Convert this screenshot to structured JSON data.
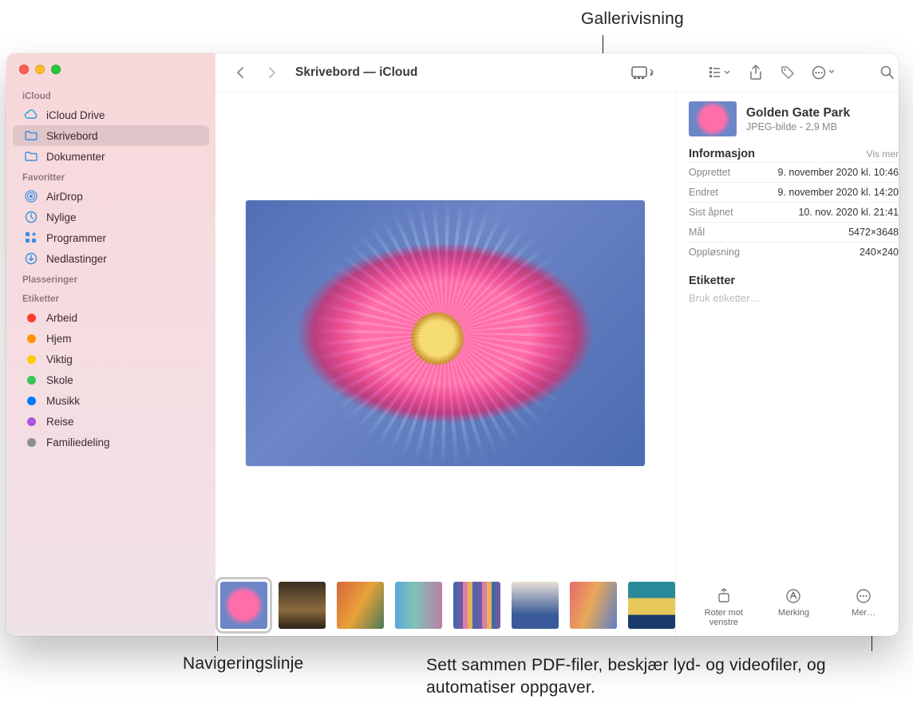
{
  "callouts": {
    "top": "Gallerivisning",
    "bottom_left": "Navigeringslinje",
    "bottom_right": "Sett sammen PDF-filer, beskjær lyd- og videofiler, og automatiser oppgaver."
  },
  "window_title": "Skrivebord — iCloud",
  "sidebar": {
    "sections": [
      {
        "header": "iCloud",
        "items": [
          {
            "label": "iCloud Drive",
            "icon": "cloud",
            "active": false
          },
          {
            "label": "Skrivebord",
            "icon": "folder",
            "active": true
          },
          {
            "label": "Dokumenter",
            "icon": "folder",
            "active": false
          }
        ]
      },
      {
        "header": "Favoritter",
        "items": [
          {
            "label": "AirDrop",
            "icon": "airdrop",
            "active": false
          },
          {
            "label": "Nylige",
            "icon": "clock",
            "active": false
          },
          {
            "label": "Programmer",
            "icon": "apps",
            "active": false
          },
          {
            "label": "Nedlastinger",
            "icon": "download",
            "active": false
          }
        ]
      },
      {
        "header": "Plasseringer",
        "items": []
      },
      {
        "header": "Etiketter",
        "items": [
          {
            "label": "Arbeid",
            "color": "#ff3b30"
          },
          {
            "label": "Hjem",
            "color": "#ff9500"
          },
          {
            "label": "Viktig",
            "color": "#ffcc00"
          },
          {
            "label": "Skole",
            "color": "#34c759"
          },
          {
            "label": "Musikk",
            "color": "#007aff"
          },
          {
            "label": "Reise",
            "color": "#af52de"
          },
          {
            "label": "Familiedeling",
            "color": "#8e8e93"
          }
        ]
      }
    ]
  },
  "info": {
    "title": "Golden Gate Park",
    "subtitle": "JPEG-bilde - 2,9 MB",
    "section_title": "Informasjon",
    "show_more": "Vis mer",
    "rows": [
      {
        "k": "Opprettet",
        "v": "9. november 2020 kl. 10:46"
      },
      {
        "k": "Endret",
        "v": "9. november 2020 kl. 14:20"
      },
      {
        "k": "Sist åpnet",
        "v": "10. nov. 2020 kl. 21:41"
      },
      {
        "k": "Mål",
        "v": "5472×3648"
      },
      {
        "k": "Oppløsning",
        "v": "240×240"
      }
    ],
    "tags_header": "Etiketter",
    "tags_placeholder": "Bruk etiketter…"
  },
  "actions": {
    "rotate": "Roter mot venstre",
    "markup": "Merking",
    "more": "Mer…"
  },
  "thumbnails": [
    {
      "selected": true,
      "bg": "radial-gradient(circle at 50% 50%,#ff6ea8 0 40%,#6d86c7 60%)"
    },
    {
      "selected": false,
      "bg": "linear-gradient(#3a2e1f,#8b6a3f 60%,#2a2318)"
    },
    {
      "selected": false,
      "bg": "linear-gradient(120deg,#d9663a,#e8a23a 50%,#4a7a56)"
    },
    {
      "selected": false,
      "bg": "linear-gradient(90deg,#5aa8d8,#7fc3b8 40%,#b97fa8)"
    },
    {
      "selected": false,
      "bg": "repeating-linear-gradient(90deg,#4a66a8 0 6px,#6f5aa8 6px 12px,#d87fa8 12px 18px,#e8b05a 18px 24px)"
    },
    {
      "selected": false,
      "bg": "linear-gradient(#e8e0d5,#3a5a9a 70%)"
    },
    {
      "selected": false,
      "bg": "linear-gradient(110deg,#e86a6a,#e8a85a 45%,#5a7fc8)"
    },
    {
      "selected": false,
      "bg": "linear-gradient(#2a8a9a 0 35%,#e8c85a 35% 70%,#1a3a6a 70%)"
    }
  ]
}
